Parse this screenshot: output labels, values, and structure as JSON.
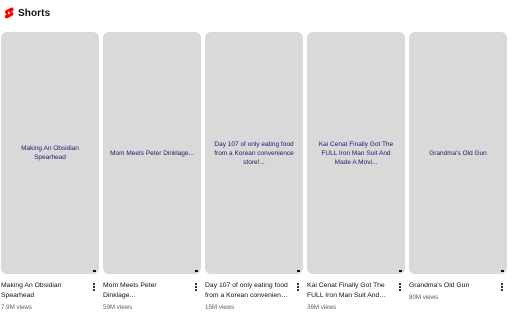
{
  "header": {
    "title": "Shorts",
    "logo_icon": "youtube-shorts-icon",
    "logo_color": "#ff0000"
  },
  "shorts": [
    {
      "thumb_title": "Making An Obsidian Spearhead",
      "title": "Making An Obsidian Spearhead",
      "views": "7.9M views"
    },
    {
      "thumb_title": "Mom Meets Peter Dinklage...",
      "title": "Mom Meets Peter Dinklage...",
      "views": "59M views"
    },
    {
      "thumb_title": "Day 107 of only eating food from a Korean convenience store!...",
      "title": "Day 107 of only eating food from a Korean convenience store!...",
      "views": "15M views"
    },
    {
      "thumb_title": "Kai Cenat Finally Got The FULL Iron Man Suit And Made A Movi...",
      "title": "Kai Cenat Finally Got The FULL Iron Man Suit And Made A Mov...",
      "views": "36M views"
    },
    {
      "thumb_title": "Grandma's Old Gun",
      "title": "Grandma's Old Gun",
      "views": "80M views"
    }
  ],
  "icons": {
    "more": "more-vertical-icon"
  },
  "colors": {
    "thumb_bg": "#d9d9d9",
    "thumb_text": "#1a1a6e",
    "secondary_text": "#606060"
  }
}
